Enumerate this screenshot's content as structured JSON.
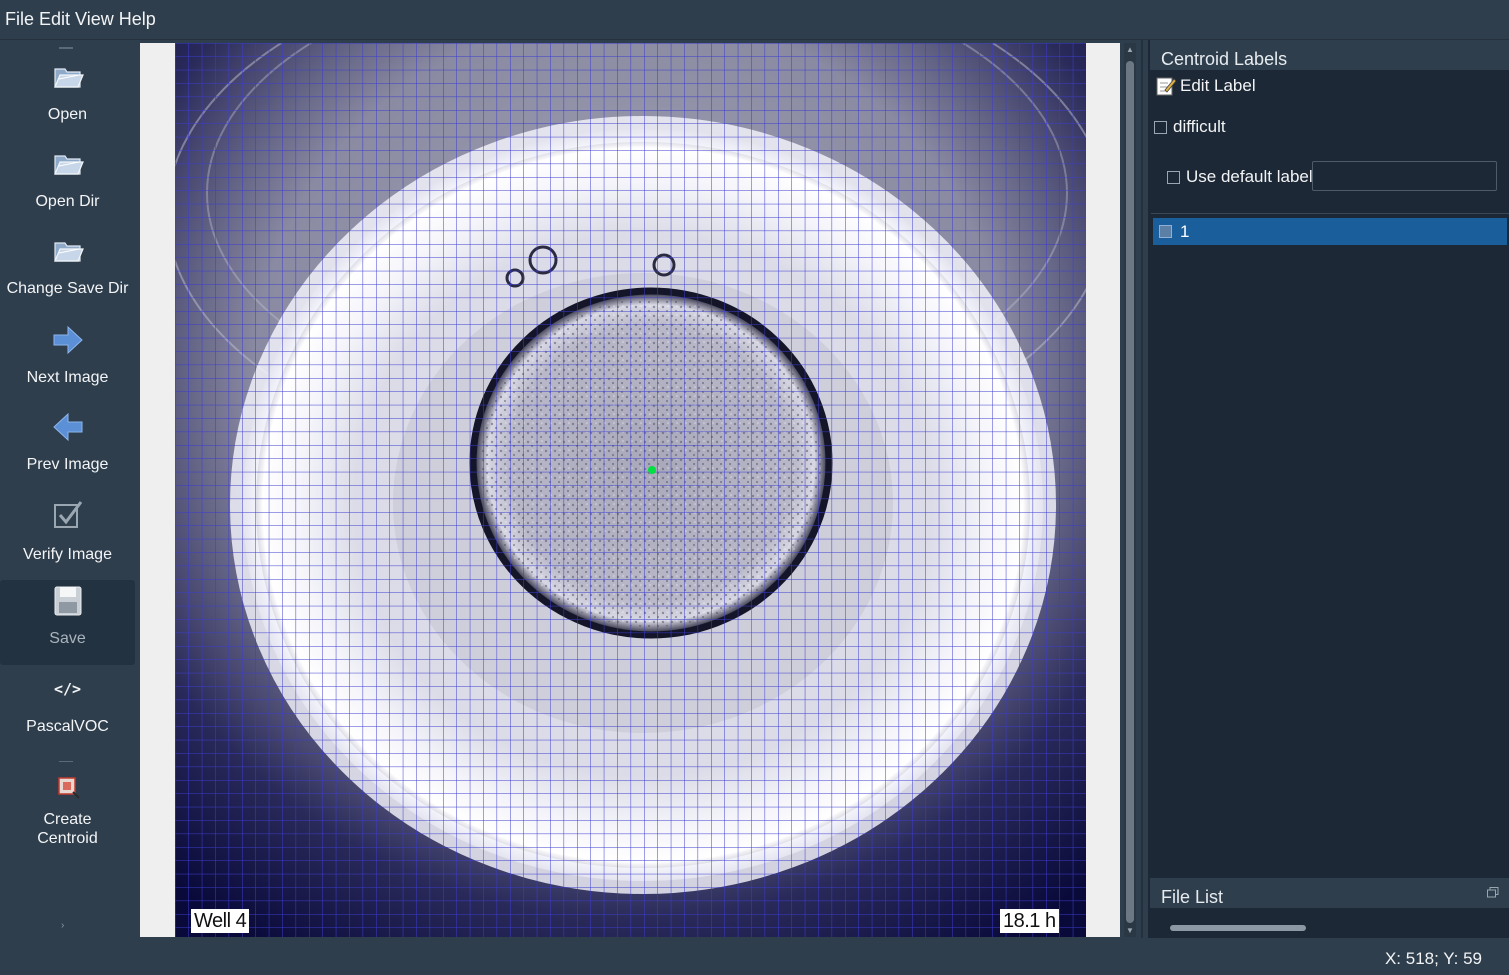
{
  "menu": [
    "File",
    "Edit",
    "View",
    "Help"
  ],
  "toolbar": {
    "open": "Open",
    "open_dir": "Open Dir",
    "change_save_dir": "Change Save Dir",
    "next_image": "Next Image",
    "prev_image": "Prev Image",
    "verify_image": "Verify Image",
    "save": "Save",
    "format": "PascalVOC",
    "create_centroid": "Create\nCentroid"
  },
  "canvas": {
    "well_label": "Well 4",
    "time_label": "18.1 h"
  },
  "right_panel": {
    "title": "Centroid Labels",
    "edit_label": "Edit Label",
    "difficult": "difficult",
    "use_default_label": "Use default label",
    "default_label_value": "",
    "labels": [
      "1"
    ],
    "file_list_title": "File List"
  },
  "status": {
    "coords": "X: 518; Y: 59"
  },
  "colors": {
    "background": "#2f3e4c",
    "panel": "#1c2835",
    "selection": "#1a5f9c",
    "grid": "#3b3bd0",
    "centroid": "#00e040"
  }
}
